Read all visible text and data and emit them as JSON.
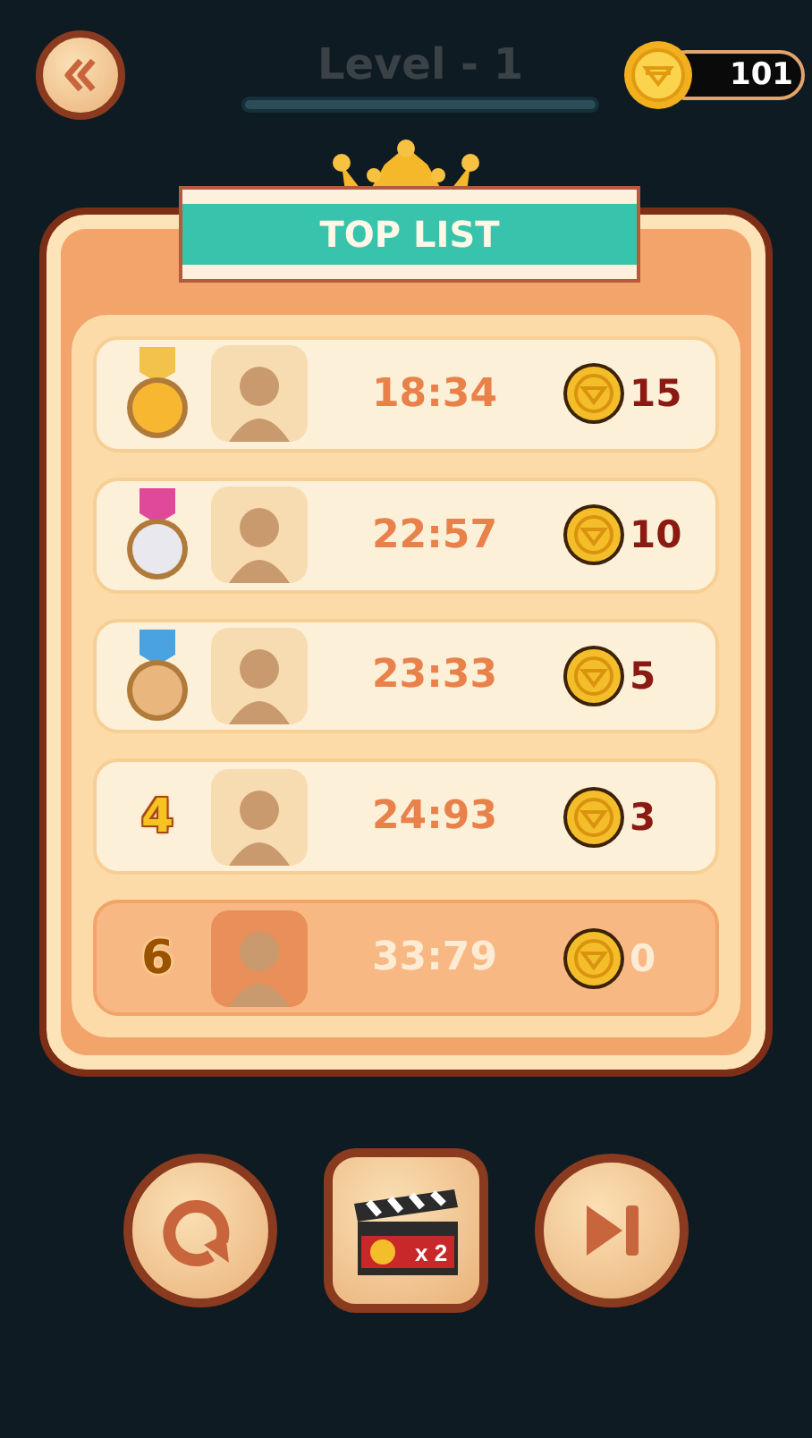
{
  "header": {
    "title": "Level - 1",
    "progress": {
      "level": 1
    },
    "coins": "101"
  },
  "banner": {
    "title": "TOP LIST"
  },
  "rows": [
    {
      "kind": "medal",
      "color": "#f7b731",
      "time": "18:34",
      "coins": "15",
      "selected": false
    },
    {
      "kind": "medal",
      "color": "#e8e8ee",
      "time": "22:57",
      "coins": "10",
      "selected": false
    },
    {
      "kind": "medal",
      "color": "#e9b77d",
      "time": "23:33",
      "coins": "5",
      "selected": false
    },
    {
      "kind": "rank",
      "rank": "4",
      "time": "24:93",
      "coins": "3",
      "selected": false
    },
    {
      "kind": "rank",
      "rank": "6",
      "time": "33:79",
      "coins": "0",
      "selected": true
    }
  ],
  "actions": {
    "reward": "x 2"
  }
}
